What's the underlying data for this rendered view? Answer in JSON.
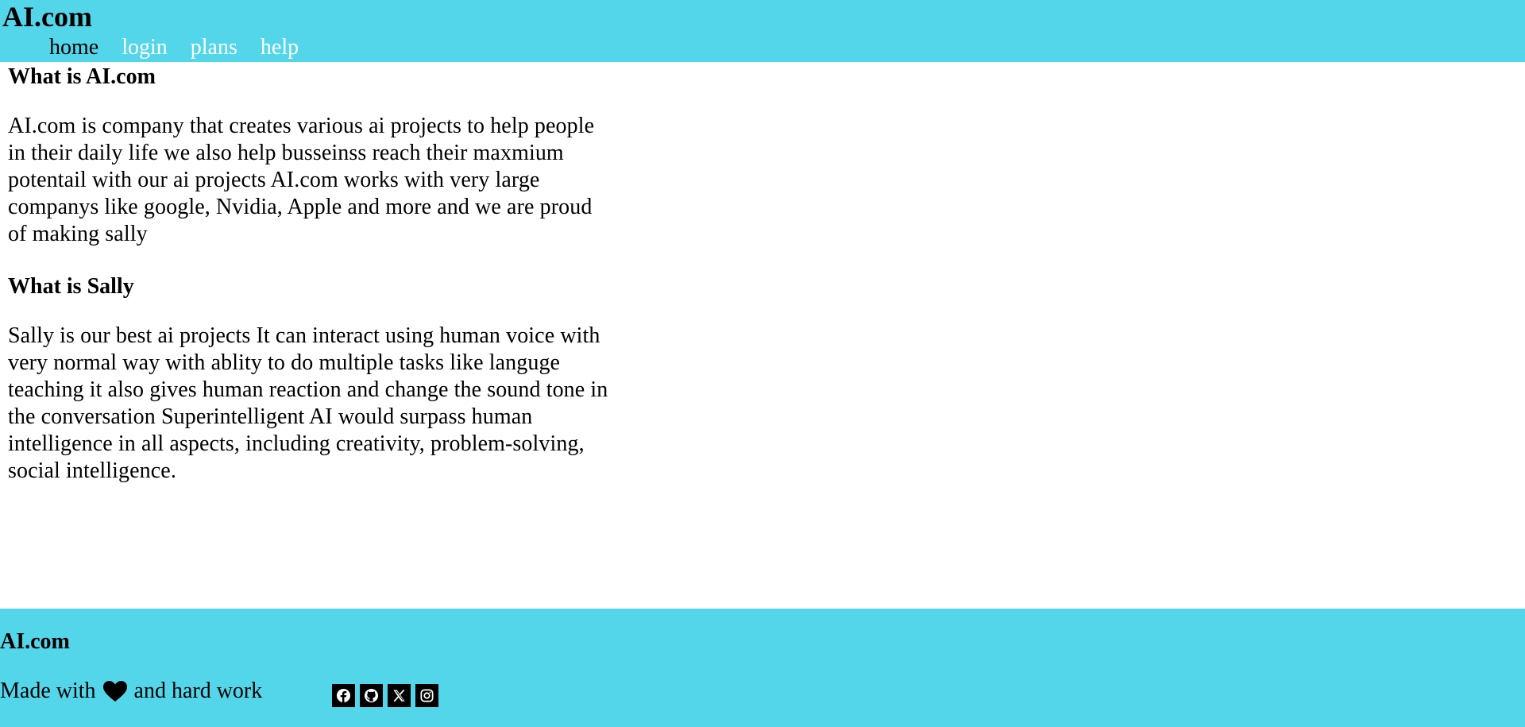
{
  "header": {
    "brand": "AI.com",
    "nav": [
      {
        "label": "home"
      },
      {
        "label": "login"
      },
      {
        "label": "plans"
      },
      {
        "label": "help"
      }
    ]
  },
  "main": {
    "section1_title": "What is AI.com",
    "section1_text": "AI.com is company that creates various ai projects to help people in their daily life we also help busseinss reach their maxmium potentail with our ai projects AI.com works with very large companys like google, Nvidia, Apple and more and we are proud of making sally",
    "section2_title": "What is Sally",
    "section2_text": "Sally is our best ai projects It can interact using human voice with very normal way with ablity to do multiple tasks like languge teaching it also gives human reaction and change the sound tone in the conversation Superintelligent AI would surpass human intelligence in all aspects, including creativity, problem-solving, social intelligence."
  },
  "footer": {
    "brand": "AI.com",
    "made_prefix": "Made with",
    "made_suffix": "and hard work",
    "heart_icon": "heart-icon",
    "socials": [
      "facebook-icon",
      "github-icon",
      "x-icon",
      "instagram-icon"
    ]
  },
  "colors": {
    "accent": "#54d6ea",
    "nav_inactive": "#ffffff",
    "nav_active": "#000000"
  }
}
